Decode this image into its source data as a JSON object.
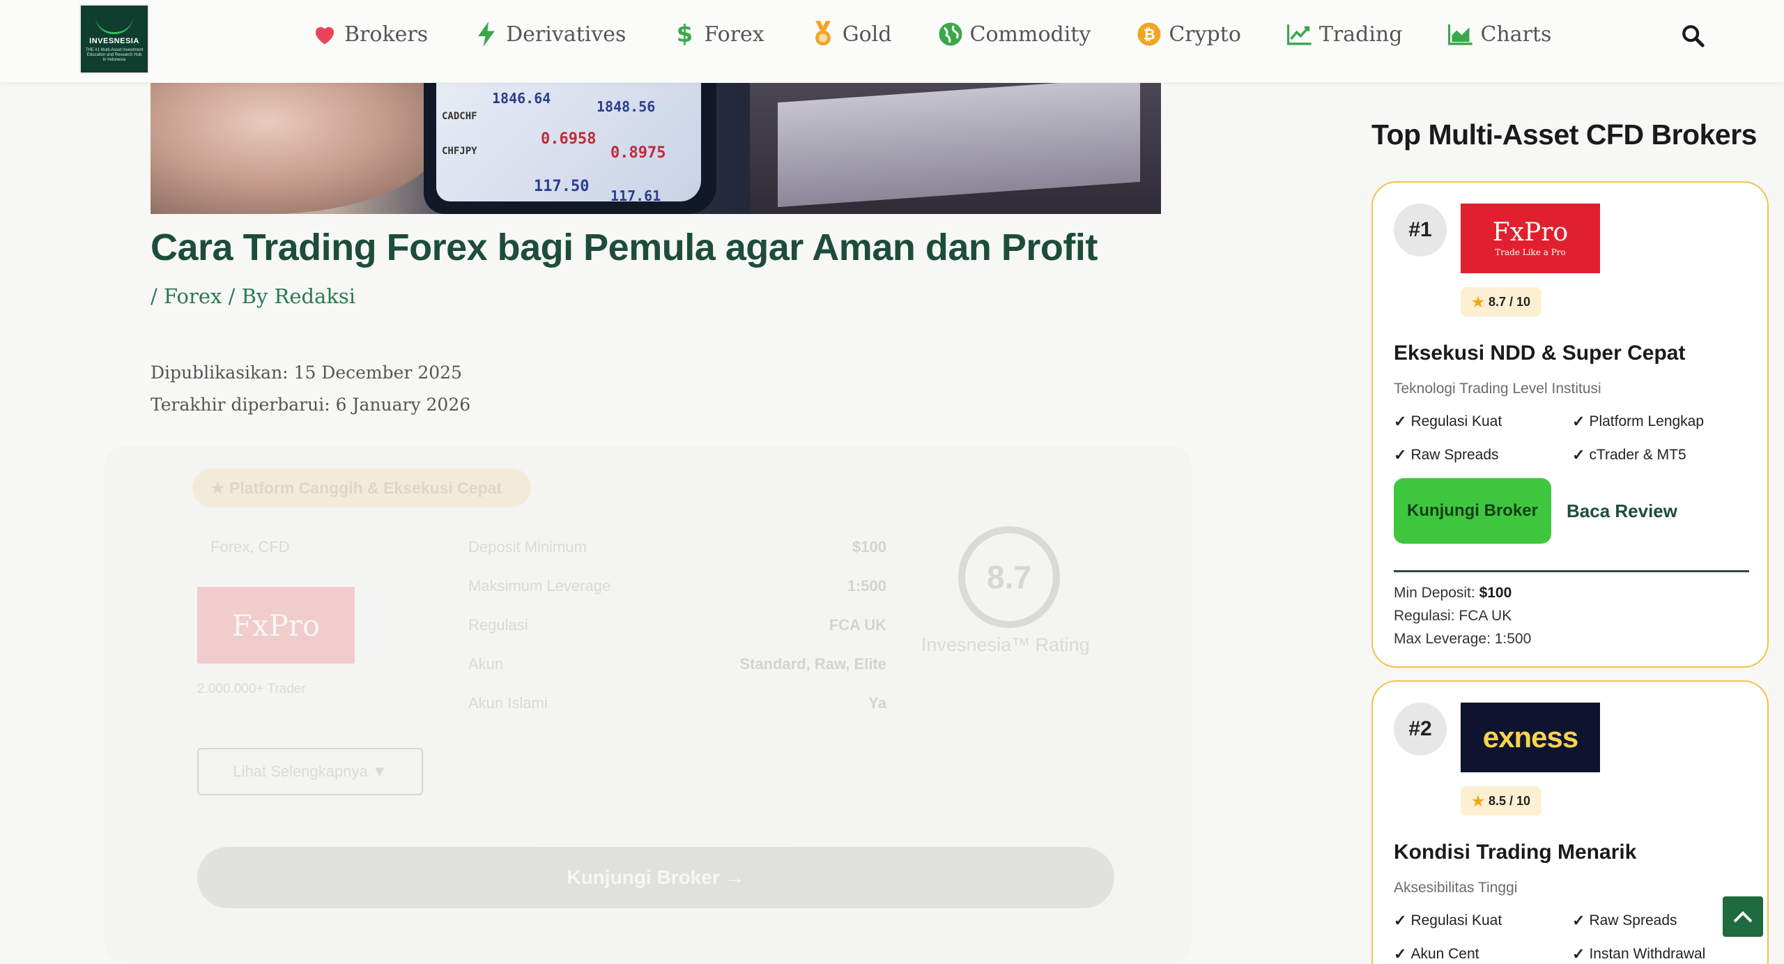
{
  "header": {
    "logo_text": "INVESNESIA",
    "logo_subtext": "THE #1 Multi-Asset Investment Education and Research Hub in Indonesia",
    "nav": [
      {
        "label": "Brokers",
        "icon": "heart-icon",
        "color": "#e8455b"
      },
      {
        "label": "Derivatives",
        "icon": "bolt-icon",
        "color": "#3aa84a"
      },
      {
        "label": "Forex",
        "icon": "dollar-icon",
        "color": "#3aa84a"
      },
      {
        "label": "Gold",
        "icon": "medal-icon",
        "color": "#f0a524"
      },
      {
        "label": "Commodity",
        "icon": "globe-icon",
        "color": "#3aa84a"
      },
      {
        "label": "Crypto",
        "icon": "bitcoin-icon",
        "color": "#f0a524"
      },
      {
        "label": "Trading",
        "icon": "line-chart-icon",
        "color": "#3aa84a"
      },
      {
        "label": "Charts",
        "icon": "area-chart-icon",
        "color": "#3aa84a"
      }
    ]
  },
  "hero": {
    "quotes": [
      "1846.64",
      "1848.56",
      "CADCHF",
      "0.6958",
      "0.8975",
      "CHFJPY",
      "117.50",
      "117.61"
    ]
  },
  "article": {
    "title": "Cara Trading Forex bagi Pemula agar Aman dan Profit",
    "meta_prefix": "/",
    "category": "Forex",
    "by_text": "/ By",
    "author": "Redaksi",
    "published": "Dipublikasikan: 15 December 2025",
    "updated": "Terakhir diperbarui: 6 January 2026"
  },
  "faded_card": {
    "pill": "★ Platform Canggih & Eksekusi Cepat",
    "tag": "Forex, CFD",
    "logo": "FxPro",
    "users": "2.000.000+ Trader",
    "rows": [
      {
        "label": "Deposit Minimum",
        "value": "$100"
      },
      {
        "label": "Maksimum Leverage",
        "value": "1:500"
      },
      {
        "label": "Regulasi",
        "value": "FCA UK"
      },
      {
        "label": "Akun",
        "value": "Standard, Raw, Elite"
      },
      {
        "label": "Akun Islami",
        "value": "Ya"
      }
    ],
    "score": "8.7",
    "score_label": "Invesnesia™ Rating",
    "details_button": "Lihat Selengkapnya ▼",
    "visit_button": "Kunjungi Broker →"
  },
  "sidebar": {
    "heading": "Top Multi-Asset CFD Brokers",
    "brokers": [
      {
        "rank": "#1",
        "logo_name": "FxPro",
        "logo_tagline": "Trade Like a Pro",
        "rating": "8.7 / 10",
        "headline": "Eksekusi NDD & Super Cepat",
        "subtitle": "Teknologi Trading Level Institusi",
        "features": [
          "Regulasi Kuat",
          "Platform Lengkap",
          "Raw Spreads",
          "cTrader & MT5"
        ],
        "visit_label": "Kunjungi Broker",
        "review_label": "Baca Review",
        "min_deposit_label": "Min Deposit:",
        "min_deposit": "$100",
        "regulation": "Regulasi: FCA UK",
        "max_leverage": "Max Leverage: 1:500"
      },
      {
        "rank": "#2",
        "logo_name": "exness",
        "rating": "8.5 / 10",
        "headline": "Kondisi Trading Menarik",
        "subtitle": "Aksesibilitas Tinggi",
        "features": [
          "Regulasi Kuat",
          "Raw Spreads",
          "Akun Cent",
          "Instan Withdrawal"
        ]
      }
    ]
  }
}
